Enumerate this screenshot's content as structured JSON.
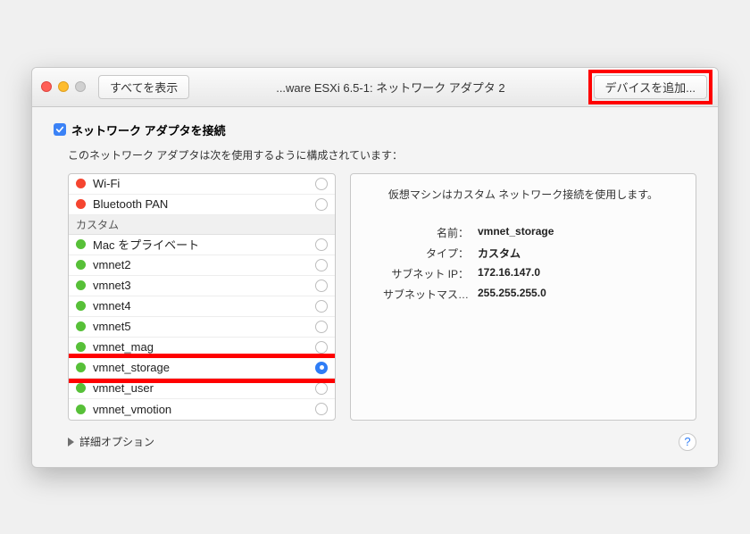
{
  "titlebar": {
    "show_all": "すべてを表示",
    "title": "...ware ESXi 6.5-1: ネットワーク アダプタ 2",
    "add_device": "デバイスを追加..."
  },
  "main": {
    "connect_label": "ネットワーク アダプタを接続",
    "description": "このネットワーク アダプタは次を使用するように構成されています：",
    "group_custom": "カスタム",
    "list": [
      {
        "dot": "red",
        "label": "Wi-Fi",
        "selected": false
      },
      {
        "dot": "red",
        "label": "Bluetooth PAN",
        "selected": false
      }
    ],
    "custom_list": [
      {
        "dot": "green",
        "label": "Mac をプライベート",
        "selected": false
      },
      {
        "dot": "green",
        "label": "vmnet2",
        "selected": false
      },
      {
        "dot": "green",
        "label": "vmnet3",
        "selected": false
      },
      {
        "dot": "green",
        "label": "vmnet4",
        "selected": false
      },
      {
        "dot": "green",
        "label": "vmnet5",
        "selected": false
      },
      {
        "dot": "green",
        "label": "vmnet_mag",
        "selected": false
      },
      {
        "dot": "green",
        "label": "vmnet_storage",
        "selected": true,
        "highlight": true
      },
      {
        "dot": "green",
        "label": "vmnet_user",
        "selected": false
      },
      {
        "dot": "green",
        "label": "vmnet_vmotion",
        "selected": false
      }
    ],
    "info": {
      "desc": "仮想マシンはカスタム ネットワーク接続を使用します。",
      "rows": [
        {
          "k": "名前：",
          "v": "vmnet_storage"
        },
        {
          "k": "タイプ：",
          "v": "カスタム"
        },
        {
          "k": "サブネット IP：",
          "v": "172.16.147.0"
        },
        {
          "k": "サブネットマス…",
          "v": "255.255.255.0"
        }
      ]
    },
    "advanced": "詳細オプション",
    "help": "?"
  }
}
